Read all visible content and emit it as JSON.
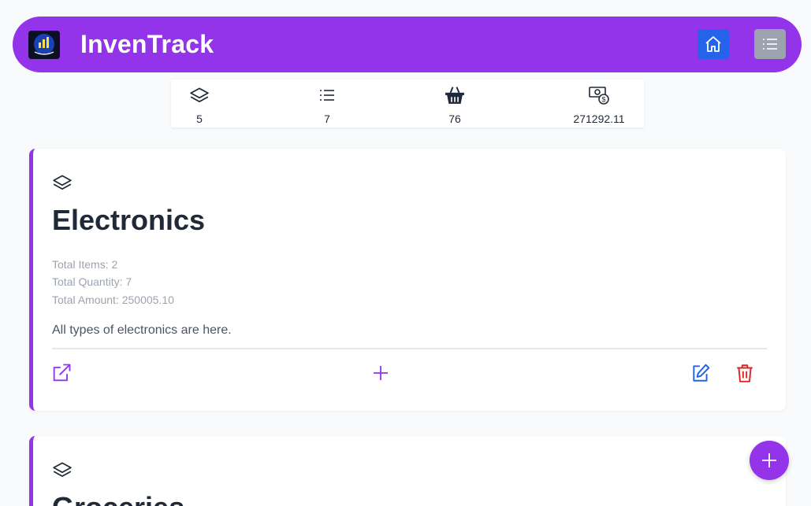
{
  "app": {
    "brand": "InvenTrack",
    "accent": "#9333ea"
  },
  "navbar": {
    "home_icon": "home-icon",
    "menu_icon": "list-icon"
  },
  "stats": [
    {
      "icon": "layers-icon",
      "value": "5"
    },
    {
      "icon": "list-icon",
      "value": "7"
    },
    {
      "icon": "basket-icon",
      "value": "76"
    },
    {
      "icon": "money-icon",
      "value": "271292.11"
    }
  ],
  "categories": [
    {
      "title": "Electronics",
      "total_items": "Total Items: 2",
      "total_quantity": "Total Quantity: 7",
      "total_amount": "Total Amount: 250005.10",
      "description": "All types of electronics are here."
    },
    {
      "title": "Groceries"
    }
  ],
  "colors": {
    "edit": "#2563eb",
    "delete": "#dc2626",
    "home_button": "#2563eb",
    "menu_button": "#9ca3af"
  }
}
